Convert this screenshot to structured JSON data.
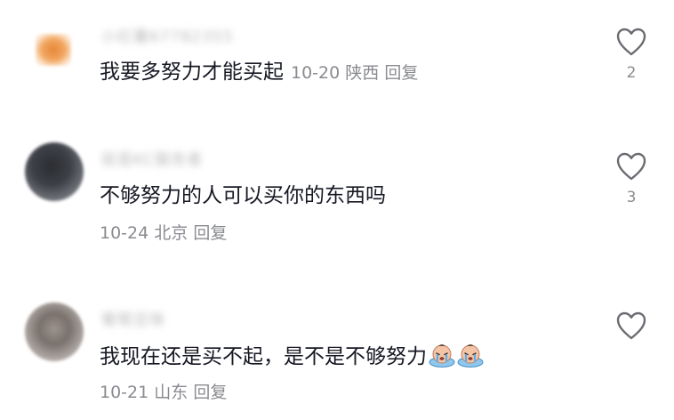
{
  "comments": [
    {
      "nickname": "小红薯67782355",
      "text": "我要多努力才能买起",
      "date": "10-20",
      "location": "陕西",
      "reply_label": "回复",
      "likes": "2"
    },
    {
      "nickname": "就是KC服务者",
      "text": "不够努力的人可以买你的东西吗",
      "date": "10-24",
      "location": "北京",
      "reply_label": "回复",
      "likes": "3"
    },
    {
      "nickname": "葡萄豆味",
      "text": "我现在还是买不起，是不是不够努力",
      "date": "10-21",
      "location": "山东",
      "reply_label": "回复",
      "likes": "",
      "emojis": [
        "crying-emoji",
        "crying-emoji"
      ]
    }
  ],
  "colors": {
    "text": "#161823",
    "meta": "#8a8b91",
    "heart_stroke": "#6b6c72"
  }
}
